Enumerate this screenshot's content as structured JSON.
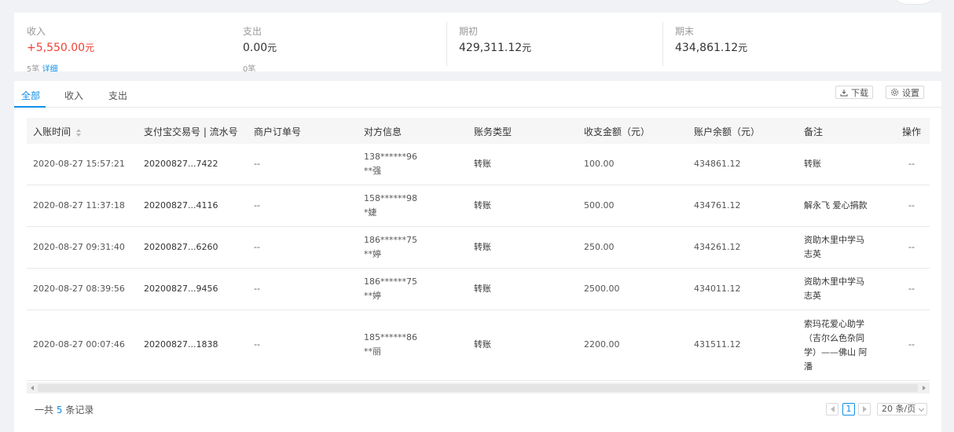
{
  "summary": {
    "income": {
      "label": "收入",
      "value": "+5,550.00",
      "unit": "元",
      "count": "5笔",
      "detail_link": "详细"
    },
    "expense": {
      "label": "支出",
      "value": "0.00",
      "unit": "元",
      "count": "0笔"
    },
    "opening": {
      "label": "期初",
      "value": "429,311.12",
      "unit": "元"
    },
    "closing": {
      "label": "期末",
      "value": "434,861.12",
      "unit": "元"
    }
  },
  "tabs": [
    {
      "label": "全部",
      "active": true
    },
    {
      "label": "收入",
      "active": false
    },
    {
      "label": "支出",
      "active": false
    }
  ],
  "toolbar": {
    "download_label": "下载",
    "download_icon": "download-icon",
    "settings_label": "设置",
    "settings_icon": "gear-icon"
  },
  "table": {
    "columns": [
      "入账时间",
      "支付宝交易号 | 流水号",
      "商户订单号",
      "对方信息",
      "账务类型",
      "收支金额（元）",
      "账户余额（元）",
      "备注",
      "操作"
    ],
    "rows": [
      {
        "time": "2020-08-27 15:57:21",
        "trade_no": "20200827...7422",
        "order_no": "--",
        "party_account": "138******96",
        "party_name": "**强",
        "type": "转账",
        "amount": "100.00",
        "balance": "434861.12",
        "remark": [
          "转账"
        ],
        "action": "--"
      },
      {
        "time": "2020-08-27 11:37:18",
        "trade_no": "20200827...4116",
        "order_no": "--",
        "party_account": "158******98",
        "party_name": "*婕",
        "type": "转账",
        "amount": "500.00",
        "balance": "434761.12",
        "remark": [
          "解永飞 爱心捐款"
        ],
        "action": "--"
      },
      {
        "time": "2020-08-27 09:31:40",
        "trade_no": "20200827...6260",
        "order_no": "--",
        "party_account": "186******75",
        "party_name": "**婷",
        "type": "转账",
        "amount": "250.00",
        "balance": "434261.12",
        "remark": [
          "资助木里中学马",
          "志英"
        ],
        "action": "--"
      },
      {
        "time": "2020-08-27 08:39:56",
        "trade_no": "20200827...9456",
        "order_no": "--",
        "party_account": "186******75",
        "party_name": "**婷",
        "type": "转账",
        "amount": "2500.00",
        "balance": "434011.12",
        "remark": [
          "资助木里中学马",
          "志英"
        ],
        "action": "--"
      },
      {
        "time": "2020-08-27 00:07:46",
        "trade_no": "20200827...1838",
        "order_no": "--",
        "party_account": "185******86",
        "party_name": "**丽",
        "type": "转账",
        "amount": "2200.00",
        "balance": "431511.12",
        "remark": [
          "索玛花爱心助学",
          "（吉尔么色杂同",
          "学）——佛山 阿",
          "潘"
        ],
        "action": "--"
      }
    ]
  },
  "footer": {
    "total_prefix": "一共",
    "total_count": "5",
    "total_suffix": "条记录",
    "current_page": "1",
    "page_size": "20 条/页"
  },
  "colors": {
    "accent": "#108ee9",
    "income": "#f04134"
  }
}
